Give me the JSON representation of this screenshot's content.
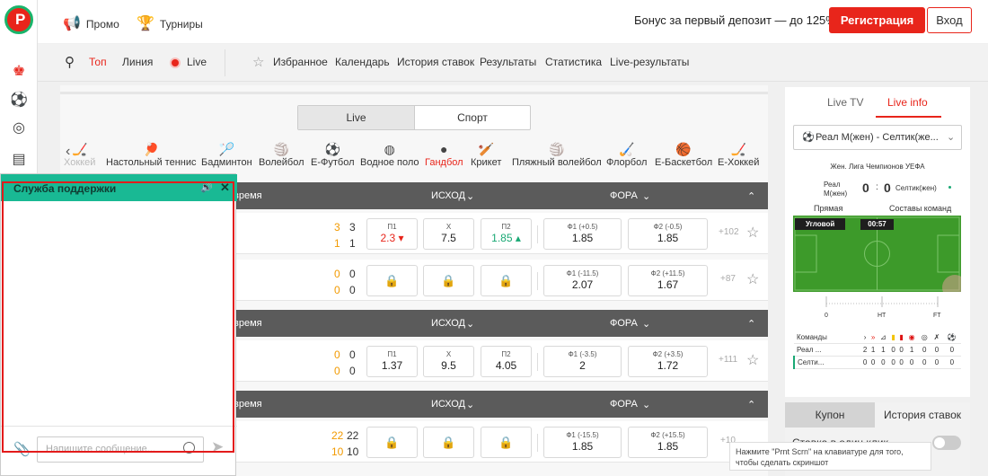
{
  "header": {
    "promo": "Промо",
    "tournaments": "Турниры",
    "bonus": "Бонус за первый депозит — до 125%",
    "register": "Регистрация",
    "login": "Вход"
  },
  "subnav": {
    "top": "Топ",
    "line": "Линия",
    "live": "Live",
    "favorites": "Избранное",
    "calendar": "Календарь",
    "history": "История ставок",
    "results": "Результаты",
    "stats": "Статистика",
    "live_results": "Live-результаты"
  },
  "segments": {
    "live": "Live",
    "sport": "Спорт"
  },
  "sports": [
    {
      "label": "Хоккей"
    },
    {
      "label": "Настольный теннис"
    },
    {
      "label": "Бадминтон"
    },
    {
      "label": "Волейбол"
    },
    {
      "label": "Е-Футбол"
    },
    {
      "label": "Водное поло"
    },
    {
      "label": "Гандбол"
    },
    {
      "label": "Крикет"
    },
    {
      "label": "Пляжный волейбол"
    },
    {
      "label": "Флорбол"
    },
    {
      "label": "Е-Баскетбол"
    },
    {
      "label": "Е-Хоккей"
    }
  ],
  "tables": [
    {
      "header": {
        "time": "время",
        "outcome": "ИСХОД",
        "handicap": "ФОРА"
      },
      "rows": [
        {
          "s1": "3",
          "s2": "3",
          "s3": "1",
          "s4": "1",
          "p1_l": "П1",
          "p1_v": "2.3 ▾",
          "x_l": "Х",
          "x_v": "7.5",
          "p2_l": "П2",
          "p2_v": "1.85 ▴",
          "f1_l": "Ф1 (+0.5)",
          "f1_v": "1.85",
          "f2_l": "Ф2 (-0.5)",
          "f2_v": "1.85",
          "more": "+102"
        },
        {
          "s1": "0",
          "s2": "0",
          "s3": "0",
          "s4": "0",
          "f1_l": "Ф1 (-11.5)",
          "f1_v": "2.07",
          "f2_l": "Ф2 (+11.5)",
          "f2_v": "1.67",
          "more": "+87"
        }
      ]
    },
    {
      "header": {
        "time": "время",
        "outcome": "ИСХОД",
        "handicap": "ФОРА"
      },
      "rows": [
        {
          "s1": "0",
          "s2": "0",
          "s3": "0",
          "s4": "0",
          "p1_l": "П1",
          "p1_v": "1.37",
          "x_l": "Х",
          "x_v": "9.5",
          "p2_l": "П2",
          "p2_v": "4.05",
          "f1_l": "Ф1 (-3.5)",
          "f1_v": "2",
          "f2_l": "Ф2 (+3.5)",
          "f2_v": "1.72",
          "more": "+111"
        }
      ]
    },
    {
      "header": {
        "time": "время",
        "outcome": "ИСХОД",
        "handicap": "ФОРА"
      },
      "rows": [
        {
          "s1": "22",
          "s2": "22",
          "s3": "10",
          "s4": "10",
          "f1_l": "Ф1 (-15.5)",
          "f1_v": "1.85",
          "f2_l": "Ф2 (+15.5)",
          "f2_v": "1.85",
          "more": "+10"
        }
      ]
    }
  ],
  "right": {
    "tab_tv": "Live TV",
    "tab_info": "Live info",
    "match": "Реал М(жен) - Селтик(же...",
    "league": "Жен. Лига Чемпионов УЕФА",
    "team1": "Реал М(жен)",
    "score1": "0",
    "colon": ":",
    "score2": "0",
    "team2": "Селтик(жен)",
    "direct": "Прямая",
    "lineups": "Составы команд",
    "corner": "Угловой",
    "clock": "00:57",
    "tl0": "0",
    "tlht": "HT",
    "tlft": "FT",
    "stats_head": "Команды",
    "stats_rows": [
      {
        "team": "Реал ...",
        "v": [
          "2",
          "1",
          "1",
          "0",
          "0",
          "1",
          "0",
          "0",
          "0"
        ]
      },
      {
        "team": "Селти...",
        "v": [
          "0",
          "0",
          "0",
          "0",
          "0",
          "0",
          "0",
          "0",
          "0"
        ]
      }
    ]
  },
  "coupon": {
    "tab1": "Купон",
    "tab2": "История ставок",
    "oneclick": "Ставка в один клик",
    "tooltip": "Нажмите \"Prnt Scrn\" на клавиатуре для того, чтобы сделать скриншот"
  },
  "chat": {
    "title": "Служба поддержки",
    "placeholder": "Напишите сообщение..."
  },
  "colors": {
    "brand": "#e8251b",
    "chat": "#19b994",
    "odds_down": "#e8251b",
    "odds_up": "#19a874"
  }
}
